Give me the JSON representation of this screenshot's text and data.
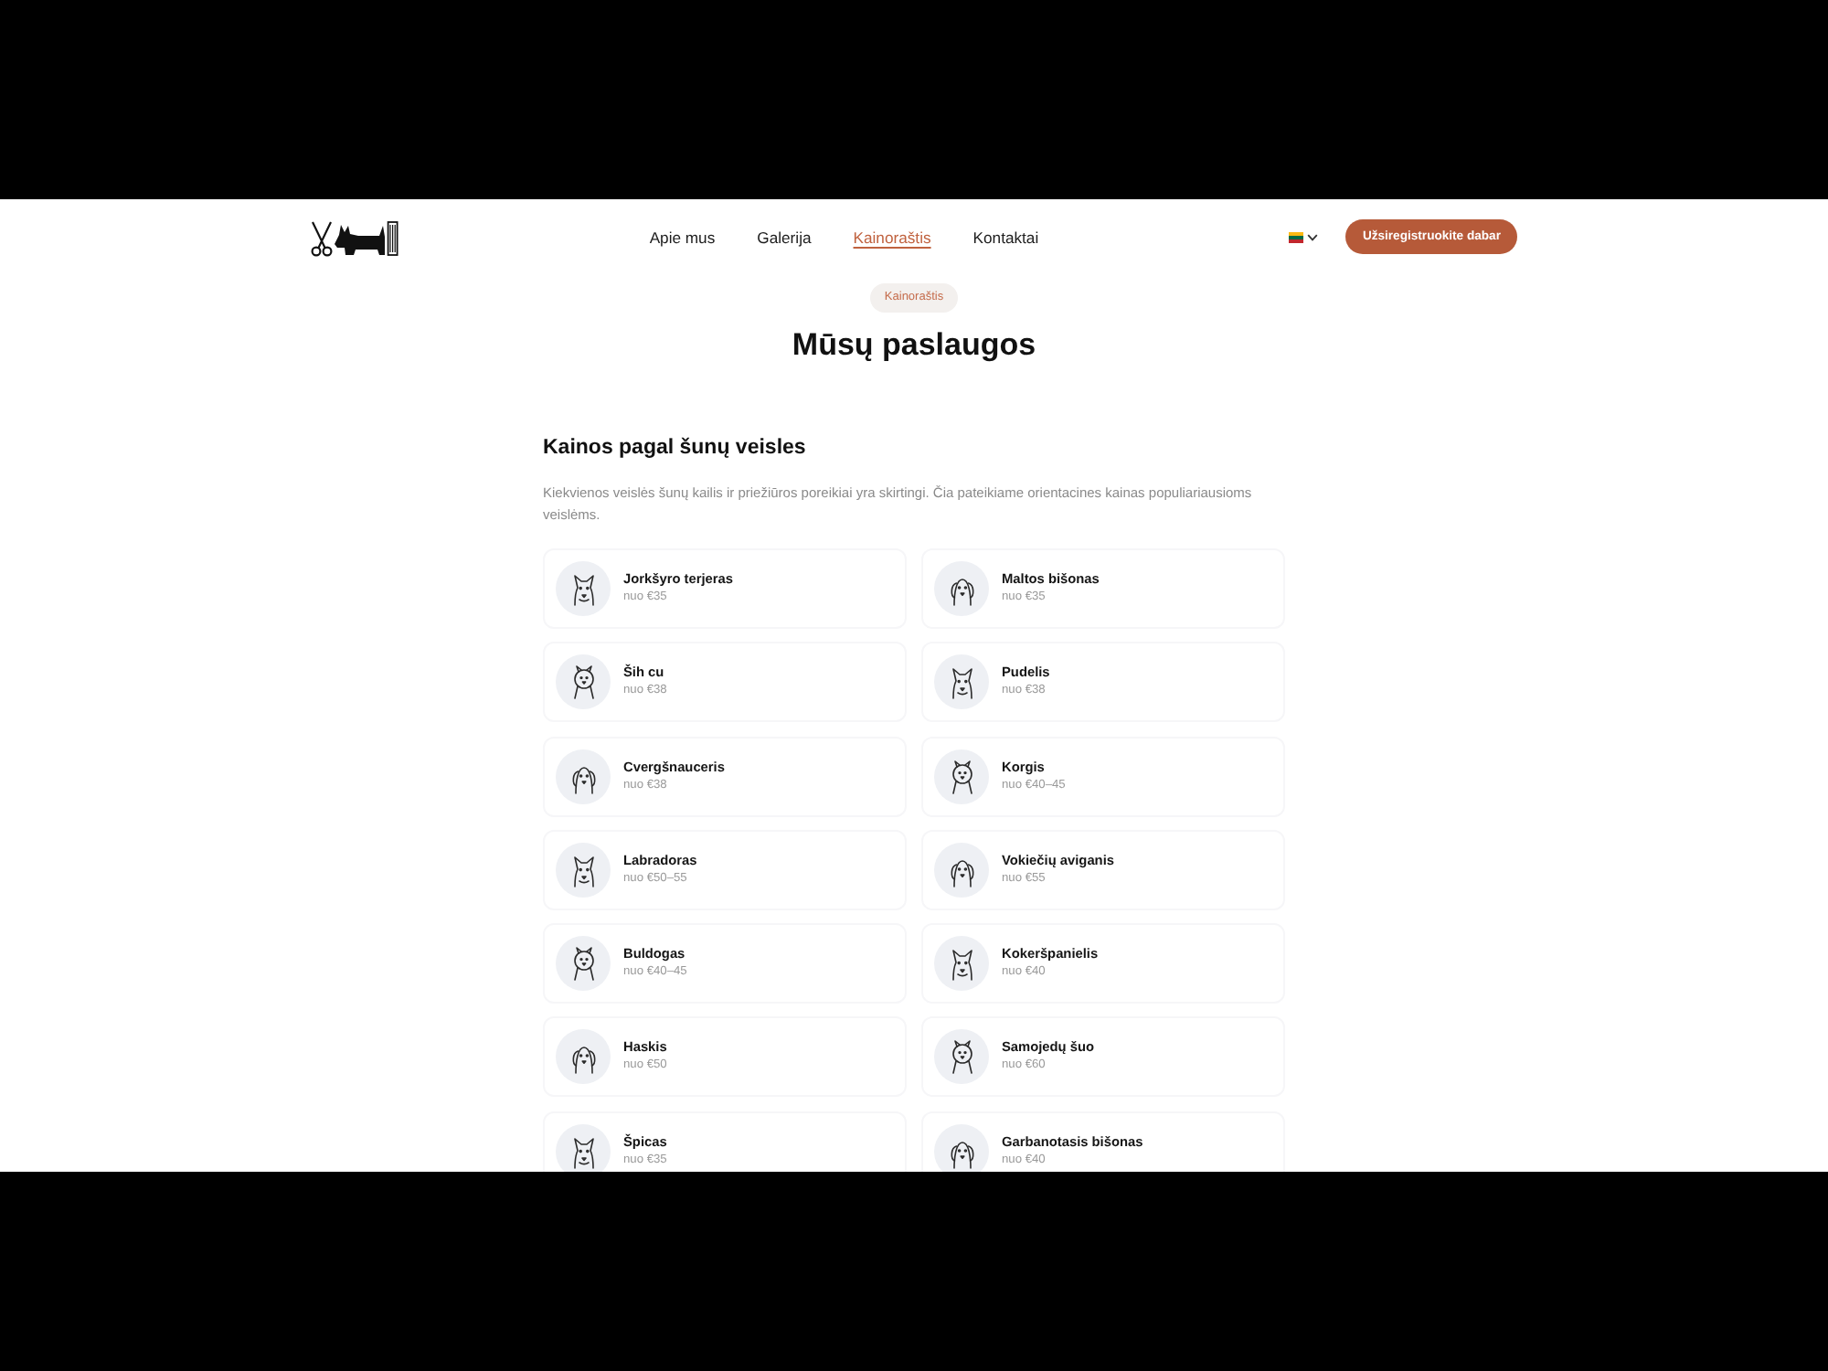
{
  "nav": {
    "items": [
      {
        "label": "Apie mus",
        "selected": false
      },
      {
        "label": "Galerija",
        "selected": false
      },
      {
        "label": "Kainoraštis",
        "selected": true
      },
      {
        "label": "Kontaktai",
        "selected": false
      }
    ]
  },
  "cta_button": "Užsiregistruokite dabar",
  "badge": "Kainoraštis",
  "title": "Mūsų paslaugos",
  "section": {
    "heading": "Kainos pagal šunų veisles",
    "description": "Kiekvienos veislės šunų kailis ir priežiūros poreikiai yra skirtingi. Čia pateikiame orientacines kainas populiariausioms veislėms.",
    "breeds": [
      {
        "name": "Jorkšyro terjeras",
        "price": "nuo €35"
      },
      {
        "name": "Maltos bišonas",
        "price": "nuo €35"
      },
      {
        "name": "Ših cu",
        "price": "nuo €38"
      },
      {
        "name": "Pudelis",
        "price": "nuo €38"
      },
      {
        "name": "Cvergšnauceris",
        "price": "nuo €38"
      },
      {
        "name": "Korgis",
        "price": "nuo €40–45"
      },
      {
        "name": "Labradoras",
        "price": "nuo €50–55"
      },
      {
        "name": "Vokiečių aviganis",
        "price": "nuo €55"
      },
      {
        "name": "Buldogas",
        "price": "nuo €40–45"
      },
      {
        "name": "Kokeršpanielis",
        "price": "nuo €40"
      },
      {
        "name": "Haskis",
        "price": "nuo €50"
      },
      {
        "name": "Samojedų šuo",
        "price": "nuo €60"
      },
      {
        "name": "Špicas",
        "price": "nuo €35"
      },
      {
        "name": "Garbanotasis bišonas",
        "price": "nuo €40"
      }
    ]
  }
}
